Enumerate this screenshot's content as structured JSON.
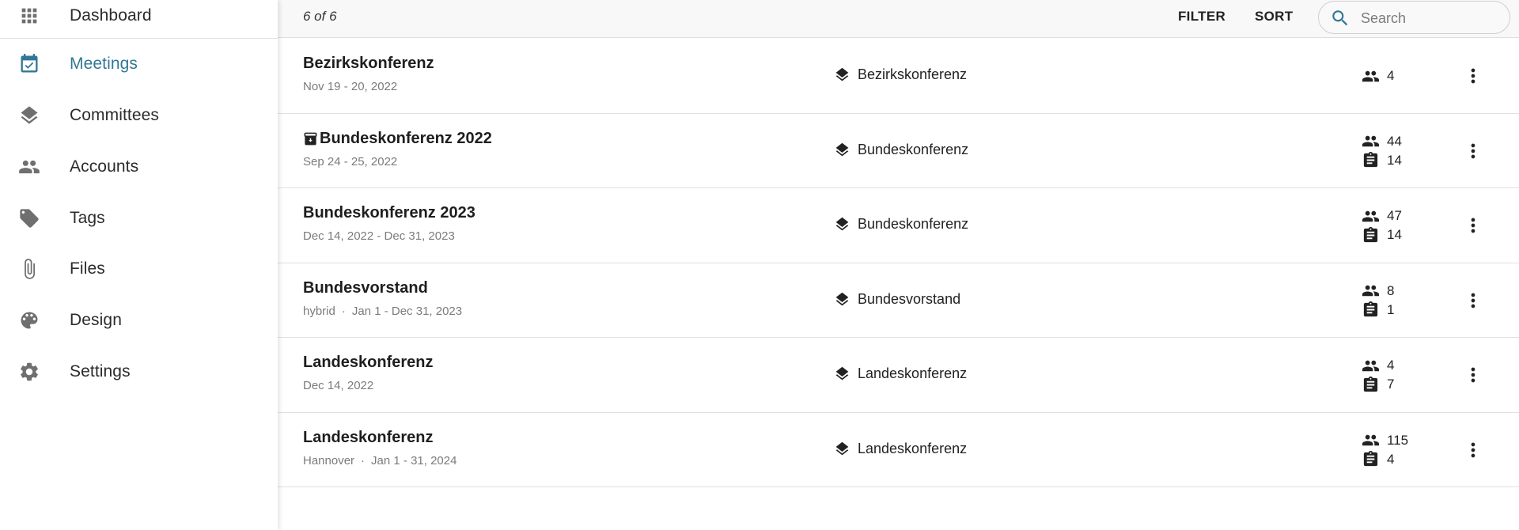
{
  "sidebar": {
    "items": [
      {
        "label": "Dashboard",
        "icon": "apps-grid-icon",
        "active": false
      },
      {
        "label": "Meetings",
        "icon": "calendar-check-icon",
        "active": true
      },
      {
        "label": "Committees",
        "icon": "layers-icon",
        "active": false
      },
      {
        "label": "Accounts",
        "icon": "people-icon",
        "active": false
      },
      {
        "label": "Tags",
        "icon": "tag-icon",
        "active": false
      },
      {
        "label": "Files",
        "icon": "paperclip-icon",
        "active": false
      },
      {
        "label": "Design",
        "icon": "palette-icon",
        "active": false
      },
      {
        "label": "Settings",
        "icon": "gear-icon",
        "active": false
      }
    ]
  },
  "header": {
    "count": "6 of 6",
    "filter_label": "FILTER",
    "sort_label": "SORT",
    "search": {
      "placeholder": "Search",
      "value": ""
    }
  },
  "colors": {
    "accent": "#317796",
    "text": "#1e1e1e",
    "muted": "#7b7b7b",
    "header_bg": "#f8f8f8"
  },
  "meetings": [
    {
      "title": "Bezirkskonferenz",
      "archived": false,
      "location": "",
      "dates": "Nov 19 - 20, 2022",
      "committee": "Bezirkskonferenz",
      "participants": "4",
      "motions": null
    },
    {
      "title": "Bundeskonferenz 2022",
      "archived": true,
      "location": "",
      "dates": "Sep 24 - 25, 2022",
      "committee": "Bundeskonferenz",
      "participants": "44",
      "motions": "14"
    },
    {
      "title": "Bundeskonferenz 2023",
      "archived": false,
      "location": "",
      "dates": "Dec 14, 2022 - Dec 31, 2023",
      "committee": "Bundeskonferenz",
      "participants": "47",
      "motions": "14"
    },
    {
      "title": "Bundesvorstand",
      "archived": false,
      "location": "hybrid",
      "dates": "Jan 1 - Dec 31, 2023",
      "committee": "Bundesvorstand",
      "participants": "8",
      "motions": "1"
    },
    {
      "title": "Landeskonferenz",
      "archived": false,
      "location": "",
      "dates": "Dec 14, 2022",
      "committee": "Landeskonferenz",
      "participants": "4",
      "motions": "7"
    },
    {
      "title": "Landeskonferenz",
      "archived": false,
      "location": "Hannover",
      "dates": "Jan 1 - 31, 2024",
      "committee": "Landeskonferenz",
      "participants": "115",
      "motions": "4"
    }
  ],
  "separator": "·"
}
